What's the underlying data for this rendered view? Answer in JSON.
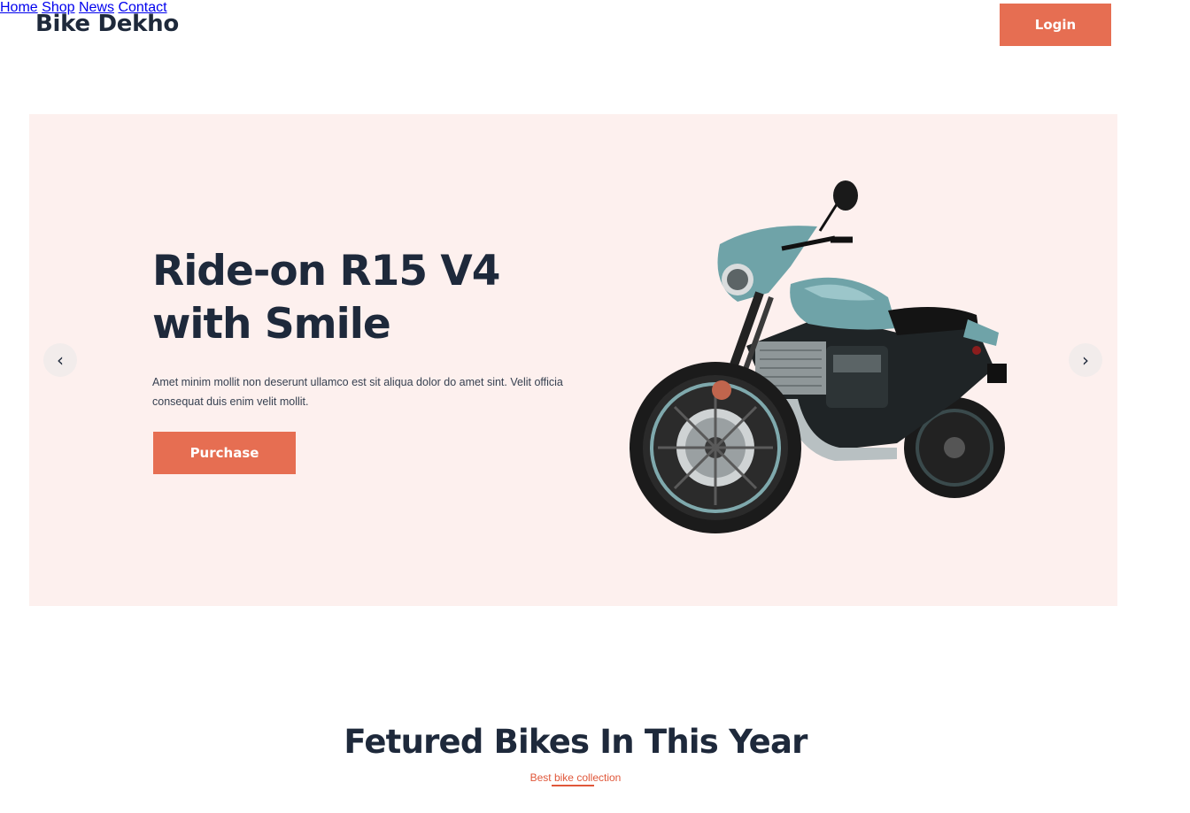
{
  "header": {
    "logo": "Bike Dekho",
    "nav": [
      "Home",
      "Shop",
      "News",
      "Contact"
    ],
    "login_label": "Login"
  },
  "hero": {
    "title_line1": "Ride-on R15 V4",
    "title_line2": "with Smile",
    "description": "Amet minim mollit non deserunt ullamco est sit aliqua dolor do amet sint. Velit officia consequat duis enim velit mollit.",
    "purchase_label": "Purchase",
    "prev_arrow": "‹",
    "next_arrow": "›"
  },
  "featured": {
    "title": "Fetured Bikes In This Year",
    "subtitle": "Best bike collection"
  },
  "colors": {
    "accent": "#e66e52",
    "hero_bg": "#fdf0ee",
    "text_dark": "#1e293b"
  },
  "icons": {
    "prev": "chevron-left-icon",
    "next": "chevron-right-icon"
  }
}
